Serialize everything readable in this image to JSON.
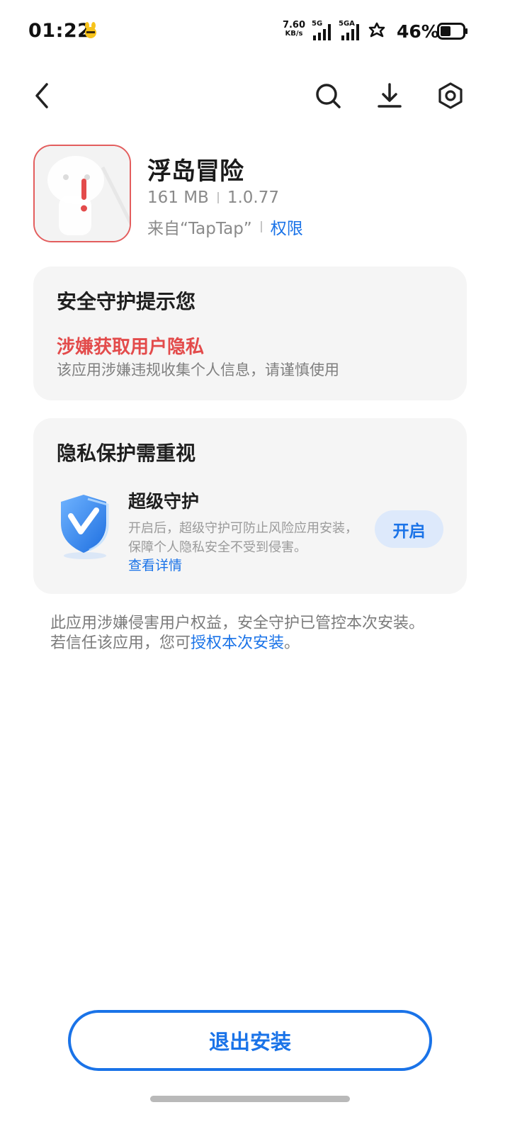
{
  "status_bar": {
    "time": "01:22",
    "net_speed_value": "7.60",
    "net_speed_unit": "KB/s",
    "signal1_label": "5G",
    "signal2_label": "5GA",
    "battery_percent": "46%",
    "battery_level": 0.46
  },
  "app": {
    "name": "浮岛冒险",
    "size": "161 MB",
    "version": "1.0.77",
    "source": "来自“TapTap”",
    "permissions_link": "权限"
  },
  "security_card": {
    "title": "安全守护提示您",
    "warning_title": "涉嫌获取用户隐私",
    "warning_desc": "该应用涉嫌违规收集个人信息，请谨慎使用"
  },
  "privacy_card": {
    "title": "隐私保护需重视",
    "feature_title": "超级守护",
    "feature_desc": "开启后，超级守护可防止风险应用安装，保障个人隐私安全不受到侵害。",
    "details_link": "查看详情",
    "enable_button": "开启"
  },
  "notice": {
    "line1": "此应用涉嫌侵害用户权益，安全守护已管控本次安装。",
    "line2_prefix": "若信任该应用，您可",
    "line2_link": "授权本次安装",
    "line2_suffix": "。"
  },
  "exit_button": "退出安装",
  "colors": {
    "accent": "#1a73e8",
    "warning": "#e34b4b",
    "card_bg": "#f5f5f5"
  }
}
